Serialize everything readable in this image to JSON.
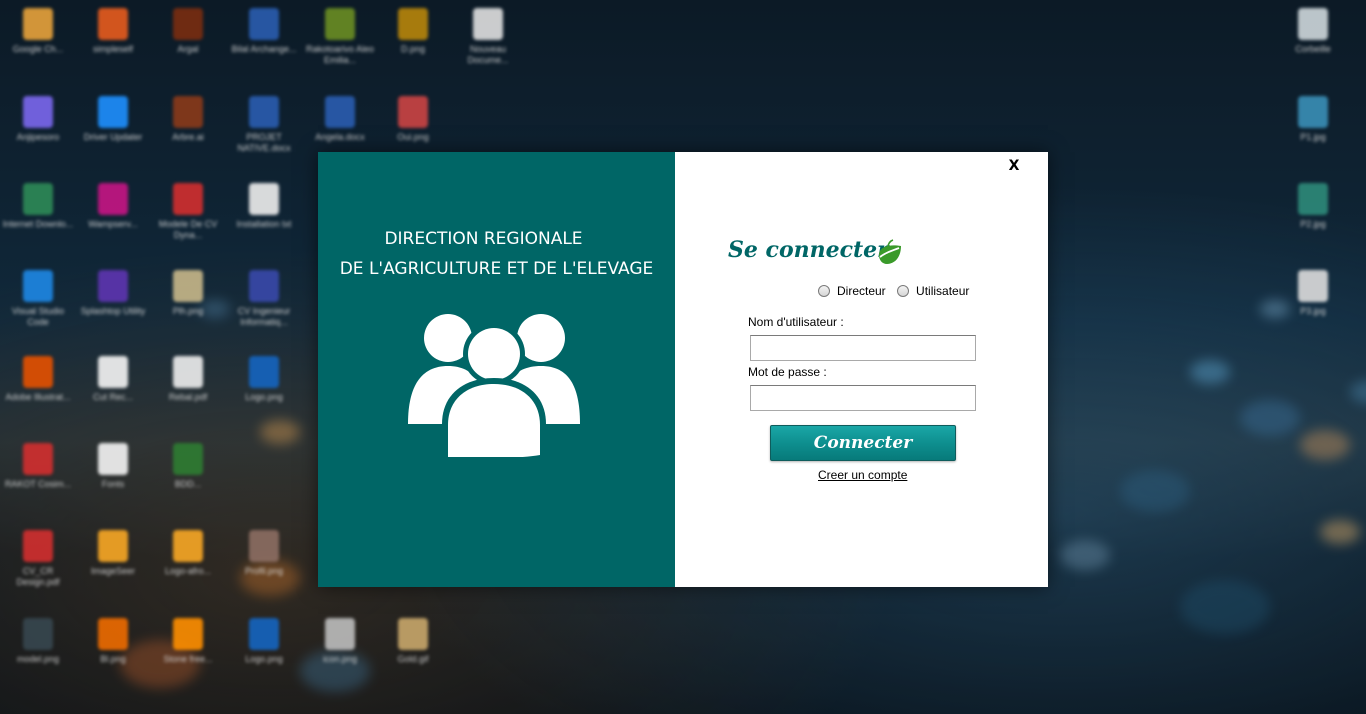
{
  "desktop": {
    "icons": [
      {
        "label": "Google Ch...",
        "color": "#e8a33b"
      },
      {
        "label": "simpleself",
        "color": "#e85c1e"
      },
      {
        "label": "Argal",
        "color": "#7a2d10"
      },
      {
        "label": "Bilal Archange...",
        "color": "#2a5db0"
      },
      {
        "label": "Rakotoarivo Aleo Emilia...",
        "color": "#6b8e23"
      },
      {
        "label": "D.png",
        "color": "#b8860b"
      },
      {
        "label": "Nouveau Docume...",
        "color": "#e0e0e0"
      },
      {
        "label": "Corbeille",
        "color": "#cfd8dc"
      },
      {
        "label": "Anjipesoro",
        "color": "#7b68ee"
      },
      {
        "label": "Driver Updater",
        "color": "#1e90ff"
      },
      {
        "label": "Arbre.ai",
        "color": "#8b3a1a"
      },
      {
        "label": "PROJET NATIVE.docx",
        "color": "#2a5db0"
      },
      {
        "label": "Angela.docx",
        "color": "#2a5db0"
      },
      {
        "label": "Oui.png",
        "color": "#cc4444"
      },
      {
        "label": "P1.jpg",
        "color": "#3a8fb7"
      },
      {
        "label": "Internet Downlo...",
        "color": "#2e8b57"
      },
      {
        "label": "Wampserv...",
        "color": "#c71585"
      },
      {
        "label": "Modele De CV Dyna...",
        "color": "#d32f2f"
      },
      {
        "label": "Installation txt",
        "color": "#eeeeee"
      },
      {
        "label": "P2.jpg",
        "color": "#2e8b7a"
      },
      {
        "label": "Visual Studio Code",
        "color": "#1e88e5"
      },
      {
        "label": "Splashtop Utility",
        "color": "#5e35b1"
      },
      {
        "label": "Plh.png",
        "color": "#c8b88a"
      },
      {
        "label": "CV Ingenieur Informatiq...",
        "color": "#3949ab"
      },
      {
        "label": "P3.jpg",
        "color": "#dddddd"
      },
      {
        "label": "Adobe Illustrat...",
        "color": "#e65100"
      },
      {
        "label": "Cut Rec...",
        "color": "#f5f5f5"
      },
      {
        "label": "Rebal.pdf",
        "color": "#eeeeee"
      },
      {
        "label": "Logo.png",
        "color": "#1565c0"
      },
      {
        "label": "RAKOT Cosim...",
        "color": "#d32f2f"
      },
      {
        "label": "Fonts",
        "color": "#f5f5f5"
      },
      {
        "label": "BDD...",
        "color": "#2e7d32"
      },
      {
        "label": "CV_CR Design.pdf",
        "color": "#d32f2f"
      },
      {
        "label": "ImageSeer",
        "color": "#f9a825"
      },
      {
        "label": "Logo-afro...",
        "color": "#f9a825"
      },
      {
        "label": "Profil.png",
        "color": "#8d6e63"
      },
      {
        "label": "model.png",
        "color": "#37474f"
      },
      {
        "label": "Bl.png",
        "color": "#ef6c00"
      },
      {
        "label": "Stone free...",
        "color": "#ff8f00"
      },
      {
        "label": "Logo.png",
        "color": "#1565c0"
      },
      {
        "label": "icon.png",
        "color": "#bdbdbd"
      },
      {
        "label": "Gold.gif",
        "color": "#c9a86b"
      }
    ]
  },
  "dialog": {
    "org_title_line1": "DIRECTION REGIONALE",
    "org_title_line2": "DE L'AGRICULTURE ET DE L'ELEVAGE",
    "close_label": "X",
    "login_title": "Se connecter",
    "roles": [
      "Directeur",
      "Utilisateur"
    ],
    "username_label": "Nom d'utilisateur :",
    "username_value": "",
    "password_label": "Mot de passe :",
    "password_value": "",
    "connect_label": "Connecter",
    "create_account_label": "Creer un compte",
    "colors": {
      "brand": "#006666",
      "button": "#0e8f8f",
      "leaf": "#3a9a2a"
    },
    "icons": {
      "users": "users-group-icon",
      "leaf": "leaf-icon"
    }
  }
}
